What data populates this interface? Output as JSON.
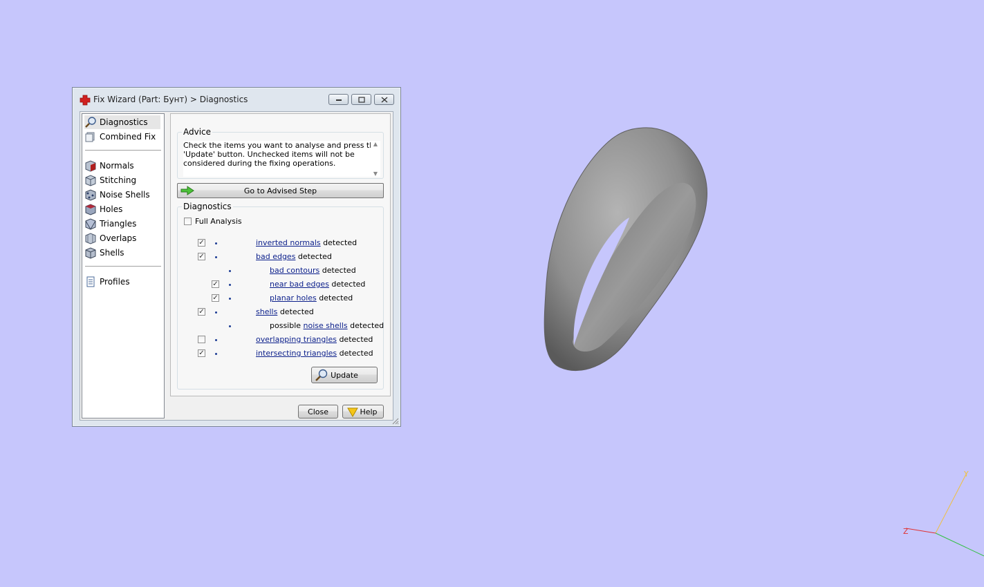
{
  "dialog": {
    "title": "Fix Wizard (Part: Бунт) > Diagnostics",
    "window_buttons": [
      "minimize",
      "restore",
      "close"
    ]
  },
  "nav": {
    "top_items": [
      {
        "label": "Diagnostics",
        "icon": "magnifier-icon",
        "selected": true
      },
      {
        "label": "Combined Fix",
        "icon": "combined-fix-icon",
        "selected": false
      }
    ],
    "tool_items": [
      {
        "label": "Normals",
        "icon": "normals-cube-icon"
      },
      {
        "label": "Stitching",
        "icon": "stitching-cube-icon"
      },
      {
        "label": "Noise Shells",
        "icon": "noise-shells-cube-icon"
      },
      {
        "label": "Holes",
        "icon": "holes-cube-icon"
      },
      {
        "label": "Triangles",
        "icon": "triangles-cube-icon"
      },
      {
        "label": "Overlaps",
        "icon": "overlaps-cube-icon"
      },
      {
        "label": "Shells",
        "icon": "shells-cube-icon"
      }
    ],
    "bottom_items": [
      {
        "label": "Profiles",
        "icon": "document-icon"
      }
    ]
  },
  "advice": {
    "group_label": "Advice",
    "text_line1": "Check the items you want to analyse and press the",
    "text_line2": "'Update' button. Unchecked items will not be",
    "text_line3": "considered during the fixing operations."
  },
  "advised_step_button": "Go to Advised Step",
  "diagnostics": {
    "group_label": "Diagnostics",
    "full_analysis_label": "Full Analysis",
    "full_analysis_checked": false,
    "rows": [
      {
        "prefix": "",
        "link": "inverted normals",
        "suffix": " detected",
        "checked": true,
        "has_checkbox": true,
        "level": 0
      },
      {
        "prefix": "",
        "link": "bad edges",
        "suffix": " detected",
        "checked": true,
        "has_checkbox": true,
        "level": 0
      },
      {
        "prefix": "",
        "link": "bad contours",
        "suffix": " detected",
        "checked": false,
        "has_checkbox": false,
        "level": 1
      },
      {
        "prefix": "",
        "link": "near bad edges",
        "suffix": " detected",
        "checked": true,
        "has_checkbox": true,
        "level": 1
      },
      {
        "prefix": "",
        "link": "planar holes",
        "suffix": " detected",
        "checked": true,
        "has_checkbox": true,
        "level": 1
      },
      {
        "prefix": "",
        "link": "shells",
        "suffix": " detected",
        "checked": true,
        "has_checkbox": true,
        "level": 0
      },
      {
        "prefix": "possible ",
        "link": "noise shells",
        "suffix": " detected",
        "checked": false,
        "has_checkbox": false,
        "level": 1
      },
      {
        "prefix": "",
        "link": "overlapping triangles",
        "suffix": " detected",
        "checked": false,
        "has_checkbox": true,
        "level": 0
      },
      {
        "prefix": "",
        "link": "intersecting triangles",
        "suffix": " detected",
        "checked": true,
        "has_checkbox": true,
        "level": 0
      }
    ],
    "update_label": "Update"
  },
  "footer": {
    "close_label": "Close",
    "help_label": "Help"
  },
  "axes": {
    "y_label": "Y",
    "z_label": "Z",
    "y_color": "#f0c040",
    "z_color": "#e03030",
    "x_color": "#30c040"
  },
  "colors": {
    "viewport_bg": "#c6c6fc",
    "link": "#0a1e8a"
  }
}
